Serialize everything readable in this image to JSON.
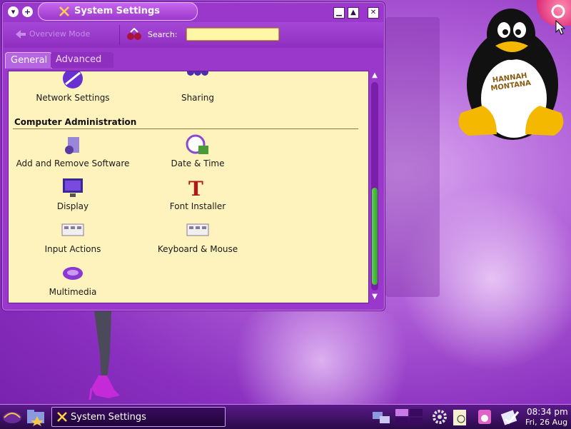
{
  "window": {
    "title": "System Settings",
    "controls": {
      "minimize": "▁",
      "maximize": "▲",
      "close": "✕"
    }
  },
  "toolbar": {
    "overview_label": "Overview Mode",
    "search_label": "Search:",
    "search_value": ""
  },
  "tabs": [
    {
      "label": "General",
      "active": true
    },
    {
      "label": "Advanced",
      "active": false
    }
  ],
  "content": {
    "top_items": [
      {
        "label": "Network Settings",
        "icon": "network-icon"
      },
      {
        "label": "Sharing",
        "icon": "sharing-icon"
      }
    ],
    "section_title": "Computer Administration",
    "items": [
      {
        "label": "Add and Remove Software",
        "icon": "software-icon"
      },
      {
        "label": "Date & Time",
        "icon": "clock-icon"
      },
      {
        "label": "Display",
        "icon": "monitor-icon"
      },
      {
        "label": "Font Installer",
        "icon": "font-icon"
      },
      {
        "label": "Input Actions",
        "icon": "input-actions-icon"
      },
      {
        "label": "Keyboard & Mouse",
        "icon": "keyboard-icon"
      },
      {
        "label": "Multimedia",
        "icon": "multimedia-icon"
      }
    ]
  },
  "desktop": {
    "mascot_text": "HANNAH MONTANA"
  },
  "taskbar": {
    "task_label": "System Settings",
    "clock_time": "08:34 pm",
    "clock_date": "Fri, 26 Aug"
  },
  "colors": {
    "accent": "#9b38cc",
    "content_bg": "#fef2bd",
    "search_bg": "#fff6a8"
  }
}
